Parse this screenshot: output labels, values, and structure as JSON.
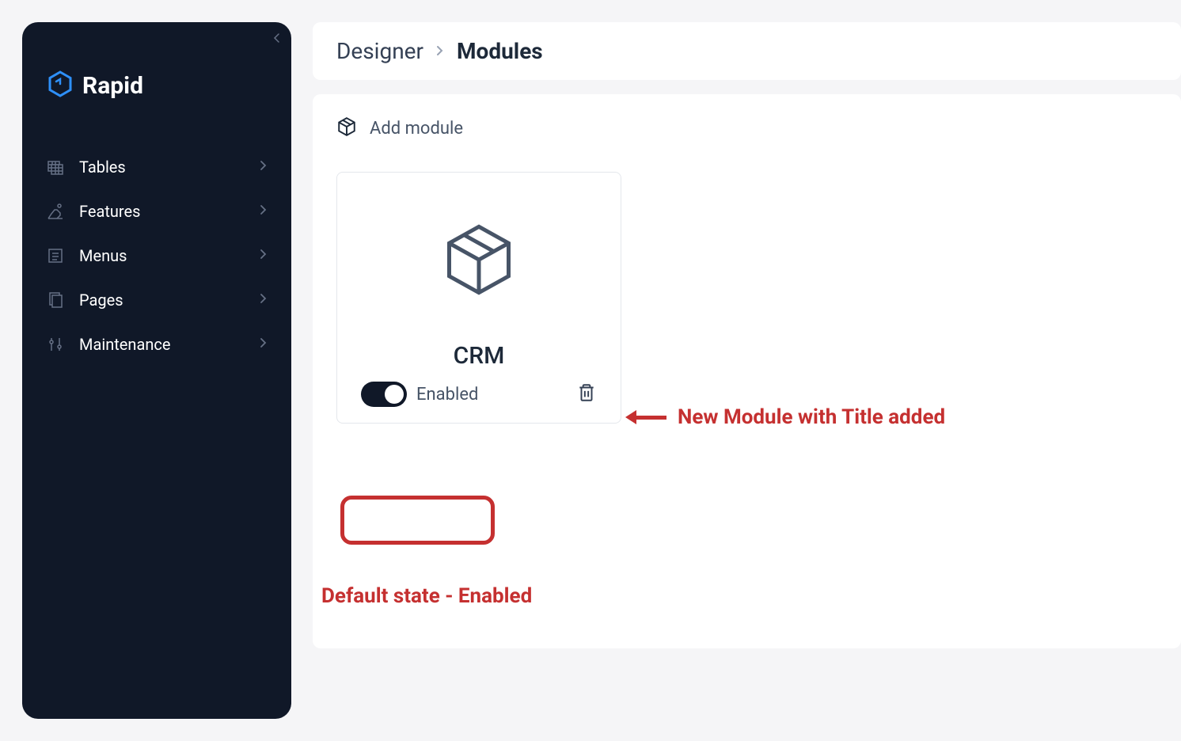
{
  "logo": {
    "text": "Rapid"
  },
  "sidebar": {
    "items": [
      {
        "label": "Tables",
        "icon": "tables-icon"
      },
      {
        "label": "Features",
        "icon": "features-icon"
      },
      {
        "label": "Menus",
        "icon": "menus-icon"
      },
      {
        "label": "Pages",
        "icon": "pages-icon"
      },
      {
        "label": "Maintenance",
        "icon": "maintenance-icon"
      }
    ]
  },
  "breadcrumb": {
    "parent": "Designer",
    "current": "Modules"
  },
  "addModule": {
    "label": "Add module"
  },
  "module": {
    "title": "CRM",
    "toggleLabel": "Enabled",
    "enabled": true
  },
  "annotations": {
    "right": "New Module with Title added",
    "bottom": "Default state - Enabled"
  },
  "colors": {
    "sidebarBg": "#101828",
    "accent": "#2e90fa",
    "annotation": "#c53030"
  }
}
